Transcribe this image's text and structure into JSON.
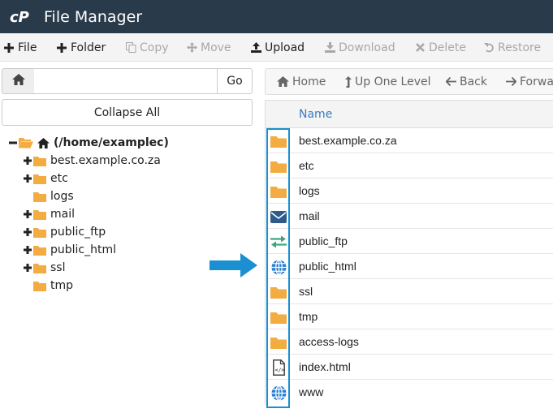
{
  "app": {
    "title": "File Manager",
    "logo": "cPanel"
  },
  "toolbar": [
    {
      "label": "File",
      "icon": "plus-icon",
      "enabled": true
    },
    {
      "label": "Folder",
      "icon": "plus-icon",
      "enabled": true
    },
    {
      "label": "Copy",
      "icon": "copy-icon",
      "enabled": false
    },
    {
      "label": "Move",
      "icon": "move-icon",
      "enabled": false
    },
    {
      "label": "Upload",
      "icon": "upload-icon",
      "enabled": true
    },
    {
      "label": "Download",
      "icon": "download-icon",
      "enabled": false
    },
    {
      "label": "Delete",
      "icon": "times-icon",
      "enabled": false
    },
    {
      "label": "Restore",
      "icon": "undo-icon",
      "enabled": false
    }
  ],
  "path_bar": {
    "value": "",
    "go_label": "Go"
  },
  "collapse_label": "Collapse All",
  "tree": {
    "root": "(/home/examplec)",
    "items": [
      {
        "label": "best.example.co.za",
        "expandable": true
      },
      {
        "label": "etc",
        "expandable": true
      },
      {
        "label": "logs",
        "expandable": false
      },
      {
        "label": "mail",
        "expandable": true
      },
      {
        "label": "public_ftp",
        "expandable": true
      },
      {
        "label": "public_html",
        "expandable": true
      },
      {
        "label": "ssl",
        "expandable": true
      },
      {
        "label": "tmp",
        "expandable": false
      }
    ]
  },
  "nav": [
    {
      "label": "Home",
      "icon": "home-icon"
    },
    {
      "label": "Up One Level",
      "icon": "level-up-icon"
    },
    {
      "label": "Back",
      "icon": "arrow-left-icon"
    },
    {
      "label": "Forward",
      "icon": "arrow-right-icon"
    }
  ],
  "table": {
    "name_header": "Name",
    "rows": [
      {
        "name": "best.example.co.za",
        "icon": "folder-icon"
      },
      {
        "name": "etc",
        "icon": "folder-icon"
      },
      {
        "name": "logs",
        "icon": "folder-icon"
      },
      {
        "name": "mail",
        "icon": "mail-icon"
      },
      {
        "name": "public_ftp",
        "icon": "exchange-icon"
      },
      {
        "name": "public_html",
        "icon": "globe-icon"
      },
      {
        "name": "ssl",
        "icon": "folder-icon"
      },
      {
        "name": "tmp",
        "icon": "folder-icon"
      },
      {
        "name": "access-logs",
        "icon": "folder-icon"
      },
      {
        "name": "index.html",
        "icon": "html-file-icon"
      },
      {
        "name": "www",
        "icon": "globe-icon"
      }
    ]
  },
  "colors": {
    "header_bg": "#293a4a",
    "folder": "#f2ac41",
    "mail": "#2d5b8c",
    "ftp": "#3aa57a",
    "globe": "#2c7fd1",
    "highlight": "#1a8fd1"
  }
}
